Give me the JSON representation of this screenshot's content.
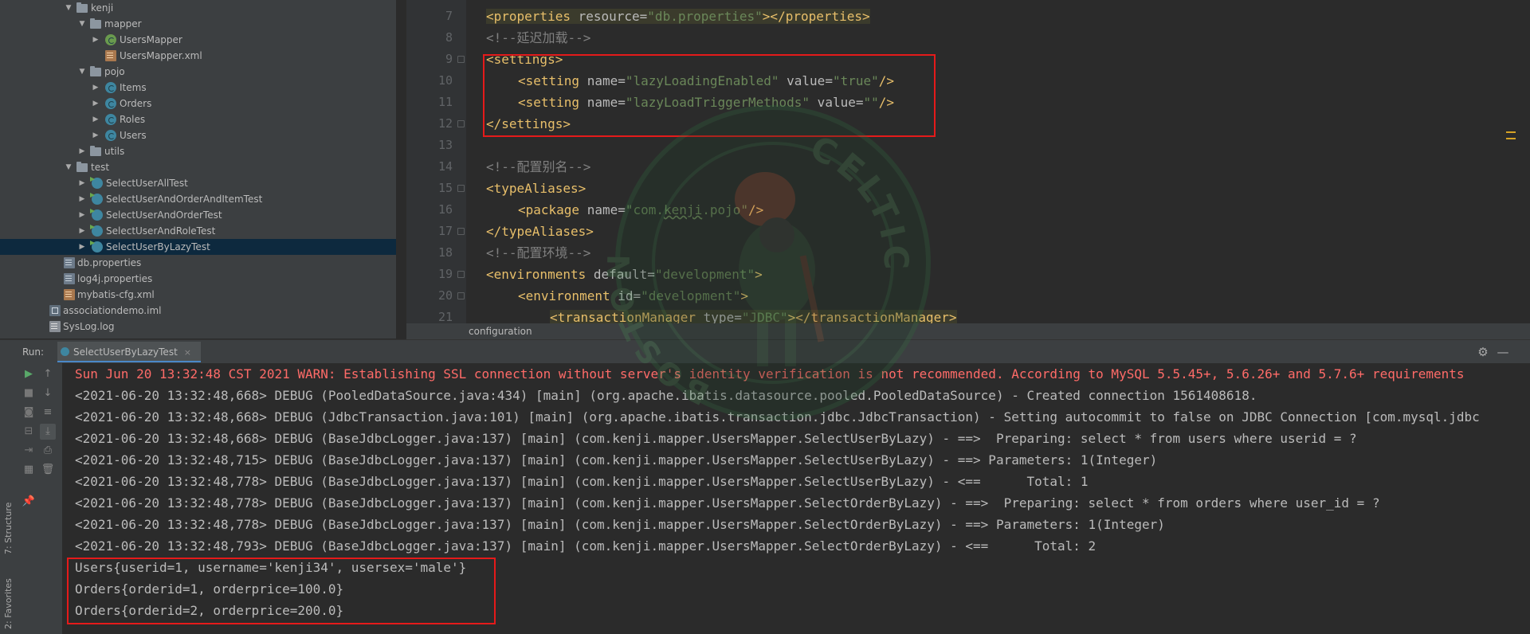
{
  "project_tree": {
    "items": [
      {
        "label": "kenji",
        "icon": "folder-icon",
        "arrow": "▼"
      },
      {
        "label": "mapper",
        "icon": "folder-icon",
        "arrow": "▼"
      },
      {
        "label": "UsersMapper",
        "icon": "interface-icon",
        "arrow": "▶"
      },
      {
        "label": "UsersMapper.xml",
        "icon": "xml-icon",
        "arrow": ""
      },
      {
        "label": "pojo",
        "icon": "folder-icon",
        "arrow": "▼"
      },
      {
        "label": "Items",
        "icon": "class-icon",
        "arrow": "▶"
      },
      {
        "label": "Orders",
        "icon": "class-icon",
        "arrow": "▶"
      },
      {
        "label": "Roles",
        "icon": "class-icon",
        "arrow": "▶"
      },
      {
        "label": "Users",
        "icon": "class-icon",
        "arrow": "▶"
      },
      {
        "label": "utils",
        "icon": "folder-icon",
        "arrow": "▶"
      },
      {
        "label": "test",
        "icon": "folder-icon",
        "arrow": "▼"
      },
      {
        "label": "SelectUserAllTest",
        "icon": "test-class-icon",
        "arrow": "▶"
      },
      {
        "label": "SelectUserAndOrderAndItemTest",
        "icon": "test-class-icon",
        "arrow": "▶"
      },
      {
        "label": "SelectUserAndOrderTest",
        "icon": "test-class-icon",
        "arrow": "▶"
      },
      {
        "label": "SelectUserAndRoleTest",
        "icon": "test-class-icon",
        "arrow": "▶"
      },
      {
        "label": "SelectUserByLazyTest",
        "icon": "test-class-icon",
        "arrow": "▶",
        "selected": true
      },
      {
        "label": "db.properties",
        "icon": "properties-file-icon",
        "arrow": ""
      },
      {
        "label": "log4j.properties",
        "icon": "properties-file-icon",
        "arrow": ""
      },
      {
        "label": "mybatis-cfg.xml",
        "icon": "xml-icon",
        "arrow": ""
      },
      {
        "label": "associationdemo.iml",
        "icon": "iml-file-icon",
        "arrow": ""
      },
      {
        "label": "SysLog.log",
        "icon": "log-file-icon",
        "arrow": ""
      }
    ]
  },
  "editor": {
    "line_numbers": [
      "7",
      "8",
      "9",
      "10",
      "11",
      "12",
      "13",
      "14",
      "15",
      "16",
      "17",
      "18",
      "19",
      "20",
      "21"
    ],
    "colors": {
      "tag": "#e8bf6a",
      "attribute": "#bababa",
      "value": "#6a8759",
      "comment": "#808080",
      "highlight_box": "#e51a1a"
    },
    "lines": {
      "l7": {
        "open": "<properties",
        "attr": " resource=",
        "val": "\"db.properties\"",
        "close": "></properties>"
      },
      "l8": {
        "comment": "<!--延迟加载-->"
      },
      "l9": {
        "tag": "<settings>"
      },
      "l10": {
        "open": "<setting",
        "attr": " name=",
        "val": "\"lazyLoadingEnabled\"",
        "attr2": " value=",
        "val2": "\"true\"",
        "close": "/>"
      },
      "l11": {
        "open": "<setting",
        "attr": " name=",
        "val": "\"lazyLoadTriggerMethods\"",
        "attr2": " value=",
        "val2": "\"\"",
        "close": "/>"
      },
      "l12": {
        "tag": "</settings>"
      },
      "l14": {
        "comment": "<!--配置别名-->"
      },
      "l15": {
        "tag": "<typeAliases>"
      },
      "l16": {
        "open": "<package",
        "attr": " name=",
        "val_a": "\"com.",
        "val_b": "kenji",
        "val_c": ".pojo\"",
        "close": "/>"
      },
      "l17": {
        "tag": "</typeAliases>"
      },
      "l18": {
        "comment": "<!--配置环境-->"
      },
      "l19": {
        "open": "<environments",
        "attr": " default=",
        "val": "\"development\"",
        "close": ">"
      },
      "l20": {
        "open": "<environment",
        "attr": " id=",
        "val": "\"development\"",
        "close": ">"
      },
      "l21": {
        "open": "<transactionManager",
        "attr": " type=",
        "val": "\"JDBC\"",
        "close": "></transactionManager>"
      }
    }
  },
  "breadcrumb": {
    "label": "configuration"
  },
  "run_panel": {
    "label": "Run:",
    "tab_label": "SelectUserByLazyTest",
    "tab_close": "×",
    "side_labels": {
      "structure": "7: Structure",
      "favorites": "2: Favorites"
    }
  },
  "console": {
    "warn_color": "#ff6b68",
    "lines": [
      "Sun Jun 20 13:32:48 CST 2021 WARN: Establishing SSL connection without server's identity verification is not recommended. According to MySQL 5.5.45+, 5.6.26+ and 5.7.6+ requirements",
      "<2021-06-20 13:32:48,668> DEBUG (PooledDataSource.java:434) [main] (org.apache.ibatis.datasource.pooled.PooledDataSource) - Created connection 1561408618.",
      "<2021-06-20 13:32:48,668> DEBUG (JdbcTransaction.java:101) [main] (org.apache.ibatis.transaction.jdbc.JdbcTransaction) - Setting autocommit to false on JDBC Connection [com.mysql.jdbc",
      "<2021-06-20 13:32:48,668> DEBUG (BaseJdbcLogger.java:137) [main] (com.kenji.mapper.UsersMapper.SelectUserByLazy) - ==>  Preparing: select * from users where userid = ?",
      "<2021-06-20 13:32:48,715> DEBUG (BaseJdbcLogger.java:137) [main] (com.kenji.mapper.UsersMapper.SelectUserByLazy) - ==> Parameters: 1(Integer)",
      "<2021-06-20 13:32:48,778> DEBUG (BaseJdbcLogger.java:137) [main] (com.kenji.mapper.UsersMapper.SelectUserByLazy) - <==      Total: 1",
      "<2021-06-20 13:32:48,778> DEBUG (BaseJdbcLogger.java:137) [main] (com.kenji.mapper.UsersMapper.SelectOrderByLazy) - ==>  Preparing: select * from orders where user_id = ?",
      "<2021-06-20 13:32:48,778> DEBUG (BaseJdbcLogger.java:137) [main] (com.kenji.mapper.UsersMapper.SelectOrderByLazy) - ==> Parameters: 1(Integer)",
      "<2021-06-20 13:32:48,793> DEBUG (BaseJdbcLogger.java:137) [main] (com.kenji.mapper.UsersMapper.SelectOrderByLazy) - <==      Total: 2",
      "Users{userid=1, username='kenji34', usersex='male'}",
      "Orders{orderid=1, orderprice=100.0}",
      "Orders{orderid=2, orderprice=200.0}"
    ]
  },
  "watermark": {
    "text_top": "CELTICS",
    "text_left": "BOSTON",
    "icon": "celtics-logo-watermark"
  }
}
